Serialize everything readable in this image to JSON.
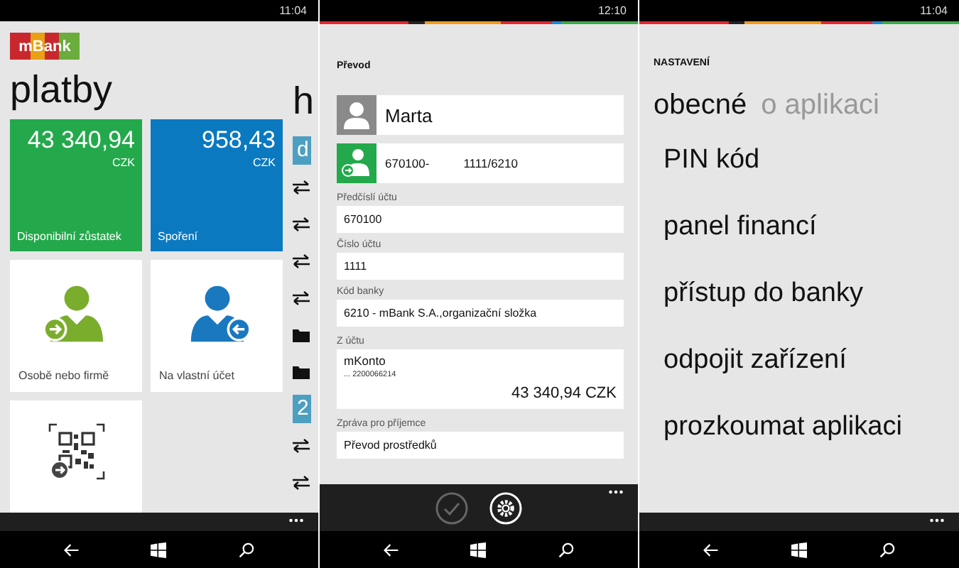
{
  "screens": [
    {
      "kind": "payments",
      "time": "11:04",
      "logo": "mBank",
      "heading": "platby",
      "more": true,
      "tiles": [
        {
          "kind": "balance",
          "amount": "43 340,94",
          "currency": "CZK",
          "label": "Disponibilní zůstatek",
          "color": "#23a94b"
        },
        {
          "kind": "balance",
          "amount": "958,43",
          "currency": "CZK",
          "label": "Spoření",
          "color": "#0a79c0"
        },
        {
          "kind": "send",
          "label": "Osobě nebo firmě",
          "color": "#7aad2c"
        },
        {
          "kind": "receive",
          "label": "Na vlastní účet",
          "color": "#1a78bf"
        },
        {
          "kind": "qr"
        }
      ],
      "peek": {
        "heading": "h",
        "items": [
          {
            "kind": "header",
            "text": "d"
          },
          {
            "kind": "transfer"
          },
          {
            "kind": "transfer"
          },
          {
            "kind": "transfer"
          },
          {
            "kind": "transfer"
          },
          {
            "kind": "folder"
          },
          {
            "kind": "folder"
          },
          {
            "kind": "header",
            "text": "2"
          },
          {
            "kind": "transfer"
          },
          {
            "kind": "transfer"
          }
        ]
      }
    },
    {
      "kind": "transfer",
      "time": "12:10",
      "accent_strip": true,
      "title": "Převod",
      "more": true,
      "contact": {
        "name": "Marta",
        "account_prefix": "670100-",
        "account": "1111/6210"
      },
      "fields": [
        {
          "label": "Předčíslí účtu",
          "value": "670100"
        },
        {
          "label": "Číslo účtu",
          "value": "1111"
        },
        {
          "label": "Kód banky",
          "value": "6210 - mBank S.A.,organizační složka"
        }
      ],
      "from_account": {
        "label": "Z účtu",
        "name": "mKonto",
        "number": "... 2200066214",
        "balance": "43 340,94 CZK"
      },
      "message": {
        "label": "Zpráva pro příjemce",
        "value": "Převod prostředků"
      },
      "actions": [
        {
          "kind": "confirm",
          "disabled": true
        },
        {
          "kind": "settings",
          "disabled": false
        }
      ]
    },
    {
      "kind": "settings",
      "time": "11:04",
      "accent_strip": true,
      "title": "NASTAVENÍ",
      "more": true,
      "tabs": [
        {
          "label": "obecné",
          "selected": true
        },
        {
          "label": "o aplikaci",
          "selected": false
        }
      ],
      "items": [
        "PIN kód",
        "panel financí",
        "přístup do banky",
        "odpojit zařízení",
        "prozkoumat aplikaci"
      ]
    }
  ]
}
